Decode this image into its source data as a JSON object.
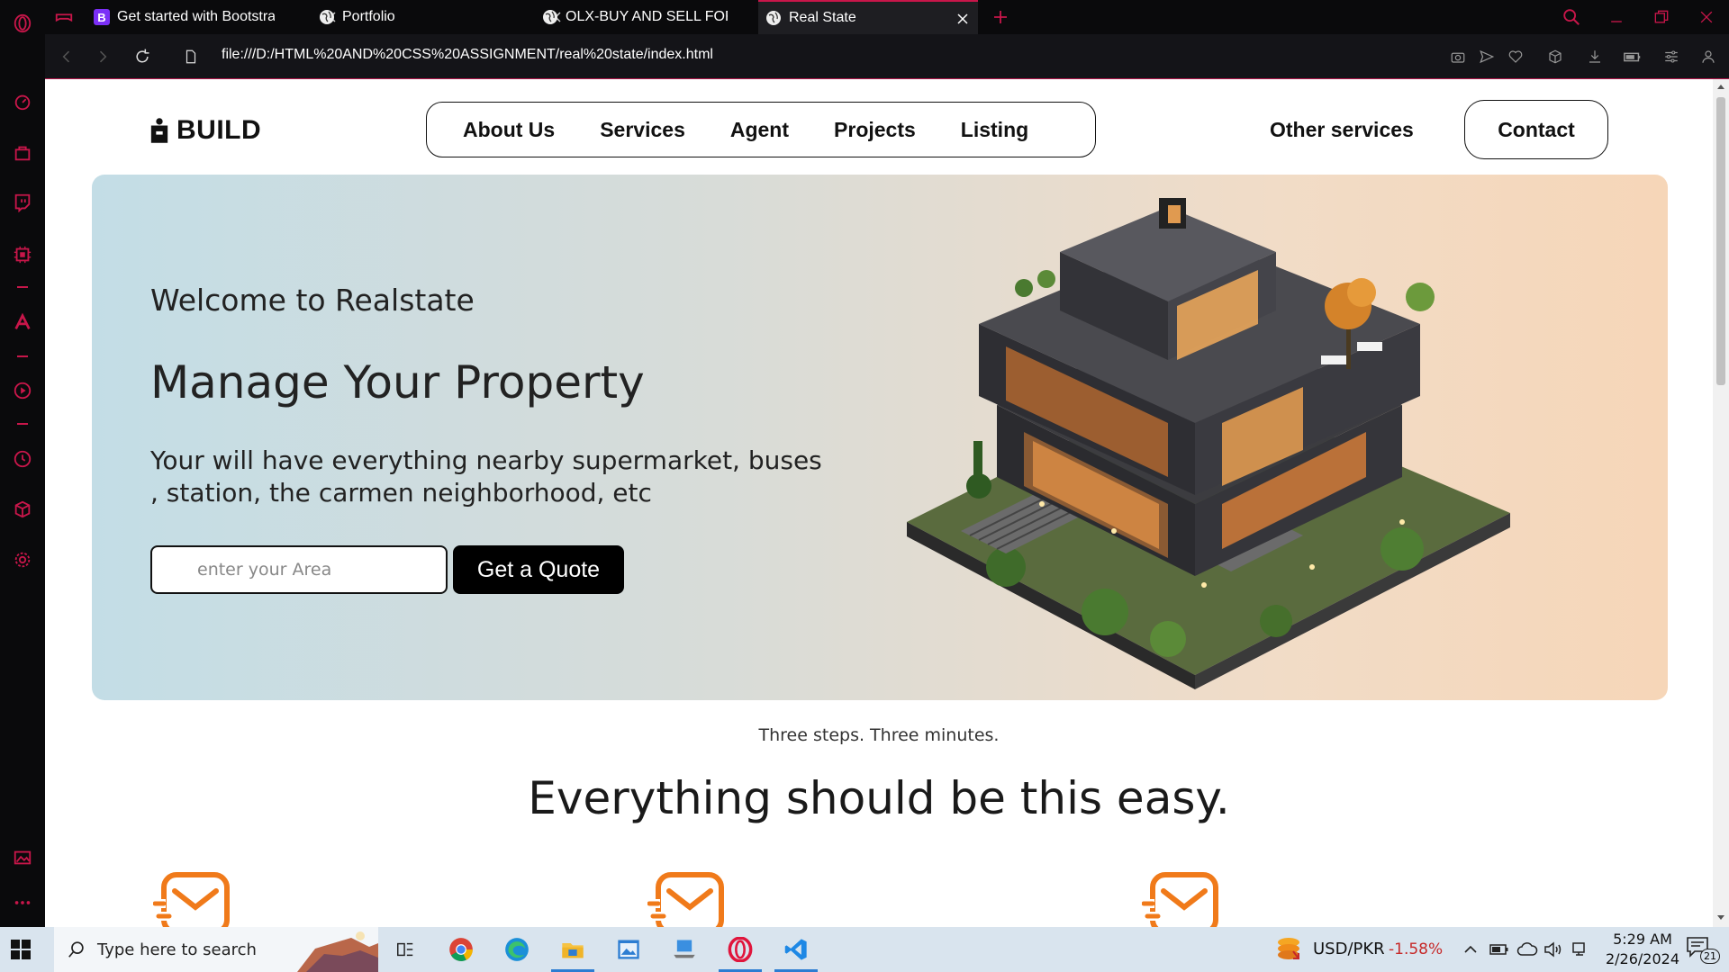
{
  "browser": {
    "tabs": [
      {
        "title": "Get started with Bootstrap",
        "favicon": "bootstrap-icon",
        "favicon_label": "B",
        "active": false
      },
      {
        "title": "Portfolio",
        "favicon": "globe-icon",
        "active": false
      },
      {
        "title": "OLX-BUY AND SELL FOR FREE",
        "favicon": "globe-icon",
        "active": false
      },
      {
        "title": "Real State",
        "favicon": "globe-icon",
        "active": true
      }
    ],
    "url": "file:///D:/HTML%20AND%20CSS%20ASSIGNMENT/real%20state/index.html",
    "accent_color": "#c8164a"
  },
  "site": {
    "logo_text": "BUILD",
    "nav": [
      "About Us",
      "Services",
      "Agent",
      "Projects",
      "Listing"
    ],
    "other_services": "Other services",
    "contact": "Contact",
    "hero": {
      "welcome": "Welcome to Realstate",
      "title": "Manage Your Property",
      "description_line1": "Your will have everything nearby supermarket, buses",
      "description_line2": ", station, the carmen neighborhood, etc",
      "input_placeholder": "enter your Area",
      "button": "Get a Quote"
    },
    "steps": {
      "subtitle": "Three steps. Three minutes.",
      "title": "Everything should be this easy."
    },
    "feature_icon_color": "#f07a1a"
  },
  "taskbar": {
    "search_placeholder": "Type here to search",
    "currency_label": "USD/PKR",
    "currency_change": "-1.58%",
    "time": "5:29 AM",
    "date": "2/26/2024",
    "notification_count": "21"
  }
}
